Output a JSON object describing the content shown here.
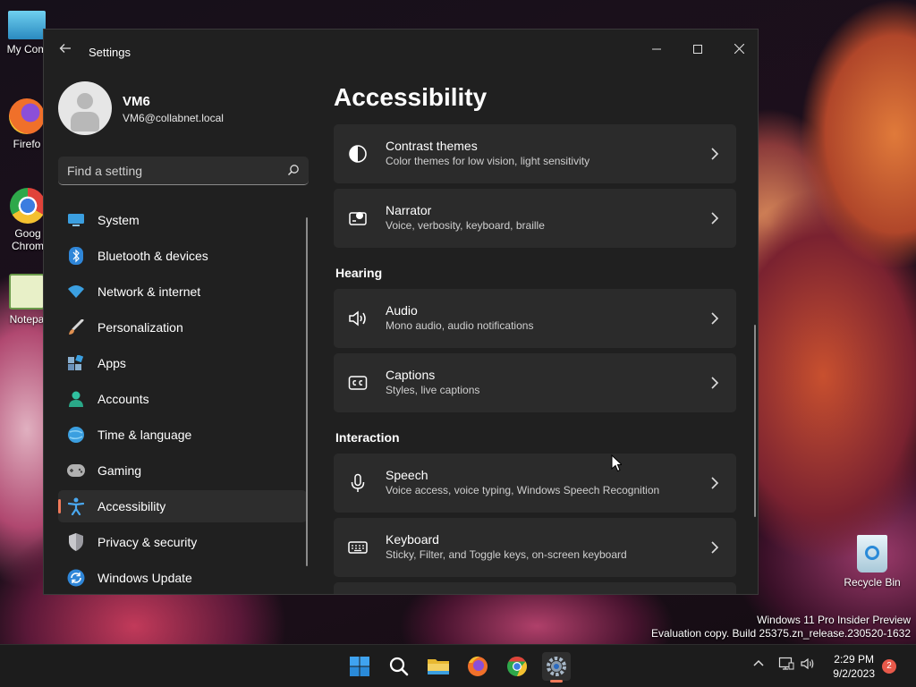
{
  "desktop": {
    "icons": [
      {
        "label": "My Com",
        "icon": "computer-icon"
      },
      {
        "label": "Firefo",
        "icon": "firefox-icon"
      },
      {
        "label": "Goog Chrom",
        "icon": "chrome-icon"
      },
      {
        "label": "Notepa",
        "icon": "notepad-icon"
      },
      {
        "label": "Recycle Bin",
        "icon": "recycle-bin-icon"
      }
    ],
    "watermark": {
      "line1": "Windows 11 Pro Insider Preview",
      "line2": "Evaluation copy. Build 25375.zn_release.230520-1632"
    }
  },
  "window": {
    "title": "Settings",
    "user": {
      "name": "VM6",
      "email": "VM6@collabnet.local"
    },
    "search": {
      "placeholder": "Find a setting"
    },
    "nav": [
      {
        "label": "System",
        "icon": "system-icon",
        "color": "#3b9fe0"
      },
      {
        "label": "Bluetooth & devices",
        "icon": "bluetooth-icon",
        "color": "#3b9fe0"
      },
      {
        "label": "Network & internet",
        "icon": "wifi-icon",
        "color": "#3b9fe0"
      },
      {
        "label": "Personalization",
        "icon": "brush-icon",
        "color": "#e09050"
      },
      {
        "label": "Apps",
        "icon": "apps-icon",
        "color": "#8ab0d0"
      },
      {
        "label": "Accounts",
        "icon": "accounts-icon",
        "color": "#30c0a0"
      },
      {
        "label": "Time & language",
        "icon": "globe-icon",
        "color": "#3b9fe0"
      },
      {
        "label": "Gaming",
        "icon": "gamepad-icon",
        "color": "#b0b0b0"
      },
      {
        "label": "Accessibility",
        "icon": "accessibility-icon",
        "color": "#4aa8f0",
        "selected": true
      },
      {
        "label": "Privacy & security",
        "icon": "shield-icon",
        "color": "#9a9aa0"
      },
      {
        "label": "Windows Update",
        "icon": "update-icon",
        "color": "#3b9fe0"
      }
    ],
    "page_title": "Accessibility",
    "cards_top": [
      {
        "title": "Contrast themes",
        "subtitle": "Color themes for low vision, light sensitivity",
        "icon": "contrast-icon"
      },
      {
        "title": "Narrator",
        "subtitle": "Voice, verbosity, keyboard, braille",
        "icon": "narrator-icon"
      }
    ],
    "section_hearing": "Hearing",
    "cards_hearing": [
      {
        "title": "Audio",
        "subtitle": "Mono audio, audio notifications",
        "icon": "speaker-icon"
      },
      {
        "title": "Captions",
        "subtitle": "Styles, live captions",
        "icon": "captions-icon"
      }
    ],
    "section_interaction": "Interaction",
    "cards_interaction": [
      {
        "title": "Speech",
        "subtitle": "Voice access, voice typing, Windows Speech Recognition",
        "icon": "microphone-icon"
      },
      {
        "title": "Keyboard",
        "subtitle": "Sticky, Filter, and Toggle keys, on-screen keyboard",
        "icon": "keyboard-icon"
      }
    ]
  },
  "taskbar": {
    "apps": [
      "start-icon",
      "search-icon",
      "file-explorer-icon",
      "firefox-icon",
      "chrome-icon",
      "settings-icon"
    ],
    "time": "2:29 PM",
    "date": "9/2/2023",
    "notifications": "2",
    "accent": "#f07a5a"
  }
}
